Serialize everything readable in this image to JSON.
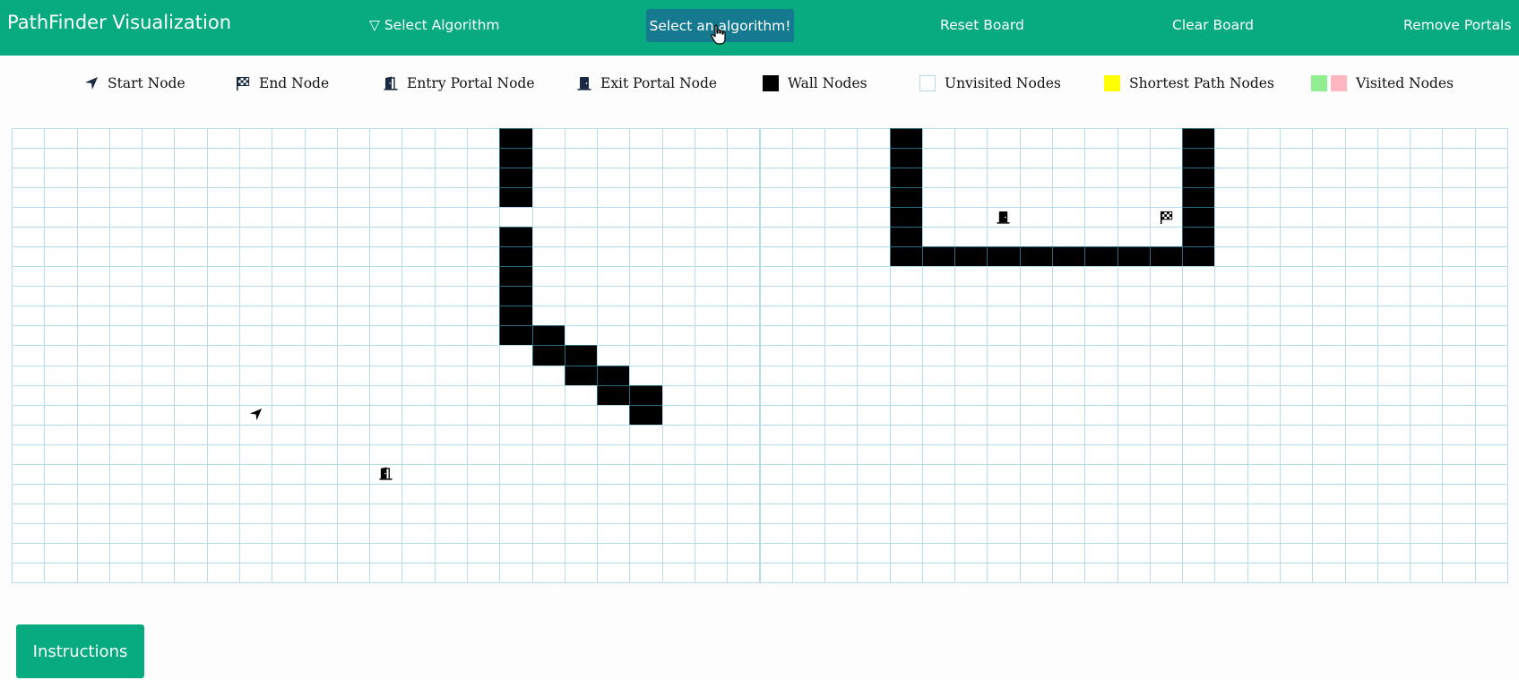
{
  "navbar": {
    "brand": "PathFinder Visualization",
    "select_algorithm": "▽ Select Algorithm",
    "visualize_button": "Select an algorithm!",
    "reset_board": "Reset Board",
    "clear_board": "Clear Board",
    "remove_portals": "Remove Portals"
  },
  "legend": {
    "start": "Start Node",
    "end": "End Node",
    "entry_portal": "Entry Portal Node",
    "exit_portal": "Exit Portal Node",
    "wall": "Wall Nodes",
    "unvisited": "Unvisited Nodes",
    "shortest_path": "Shortest Path Nodes",
    "visited": "Visited Nodes"
  },
  "colors": {
    "primary": "#07ab7f",
    "button_active": "#157a90",
    "wall": "#000000",
    "unvisited_border": "#b4dcec",
    "shortest_path": "#ffff00",
    "visited_green": "#90ee90",
    "visited_pink": "#ffb6c1",
    "icon": "#1a2a44"
  },
  "grid": {
    "rows": 23,
    "cols": 46,
    "walls": [
      [
        0,
        15
      ],
      [
        1,
        15
      ],
      [
        2,
        15
      ],
      [
        3,
        15
      ],
      [
        5,
        15
      ],
      [
        6,
        15
      ],
      [
        7,
        15
      ],
      [
        8,
        15
      ],
      [
        9,
        15
      ],
      [
        10,
        15
      ],
      [
        10,
        16
      ],
      [
        11,
        16
      ],
      [
        11,
        17
      ],
      [
        12,
        17
      ],
      [
        12,
        18
      ],
      [
        13,
        18
      ],
      [
        13,
        19
      ],
      [
        14,
        19
      ],
      [
        0,
        27
      ],
      [
        1,
        27
      ],
      [
        2,
        27
      ],
      [
        3,
        27
      ],
      [
        4,
        27
      ],
      [
        5,
        27
      ],
      [
        6,
        27
      ],
      [
        6,
        28
      ],
      [
        6,
        29
      ],
      [
        6,
        30
      ],
      [
        6,
        31
      ],
      [
        6,
        32
      ],
      [
        6,
        33
      ],
      [
        6,
        34
      ],
      [
        6,
        35
      ],
      [
        6,
        36
      ],
      [
        0,
        36
      ],
      [
        1,
        36
      ],
      [
        2,
        36
      ],
      [
        3,
        36
      ],
      [
        4,
        36
      ],
      [
        5,
        36
      ]
    ],
    "start": [
      14,
      7
    ],
    "end": [
      4,
      35
    ],
    "entry_portal": [
      17,
      11
    ],
    "exit_portal": [
      4,
      30
    ]
  },
  "instructions_button": "Instructions"
}
